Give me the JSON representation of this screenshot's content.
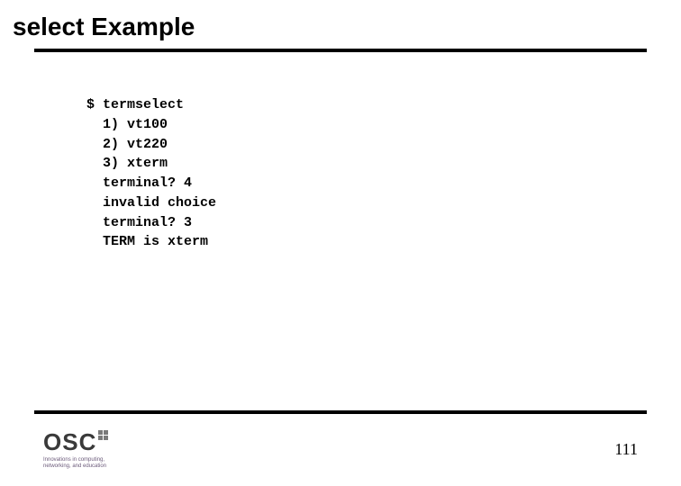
{
  "title": "select Example",
  "code": {
    "prompt": "$ ",
    "cmd": "termselect",
    "opt1": "1) vt100",
    "opt2": "2) vt220",
    "opt3": "3) xterm",
    "q1": "terminal? ",
    "a1": "4",
    "err": "invalid choice",
    "q2": "terminal? ",
    "a2": "3",
    "result": "TERM is xterm"
  },
  "logo": {
    "text": "OSC",
    "tag1": "Innovations in computing,",
    "tag2": "networking, and education"
  },
  "page_number": "111"
}
